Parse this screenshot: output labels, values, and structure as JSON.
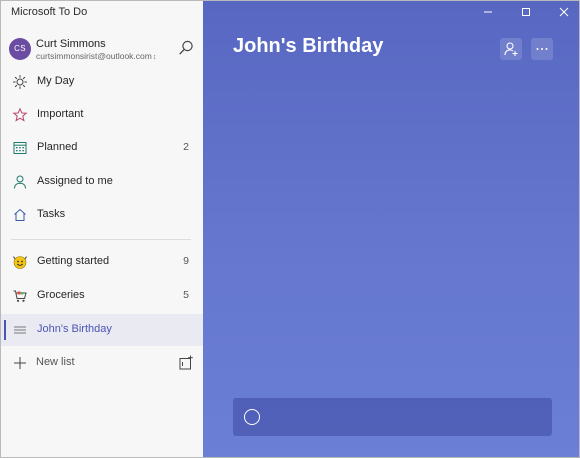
{
  "app": {
    "title": "Microsoft To Do"
  },
  "account": {
    "initials": "CS",
    "name": "Curt Simmons",
    "email": "curtsimmonsirist@outlook.com",
    "chevron": "⌃⌄"
  },
  "sidebar": {
    "smart_lists": [
      {
        "label": "My Day",
        "icon": "sun-icon",
        "count": ""
      },
      {
        "label": "Important",
        "icon": "star-icon",
        "count": ""
      },
      {
        "label": "Planned",
        "icon": "calendar-icon",
        "count": "2"
      },
      {
        "label": "Assigned to me",
        "icon": "person-icon",
        "count": ""
      },
      {
        "label": "Tasks",
        "icon": "home-icon",
        "count": ""
      }
    ],
    "lists": [
      {
        "label": "Getting started",
        "icon": "smiley-emoji-icon",
        "count": "9"
      },
      {
        "label": "Groceries",
        "icon": "shopping-cart-emoji-icon",
        "count": "5"
      },
      {
        "label": "John's Birthday",
        "icon": "list-lines-icon",
        "count": "",
        "active": true
      }
    ],
    "new_list_label": "New list"
  },
  "main": {
    "title": "John's Birthday",
    "add_task_placeholder": "",
    "background_color": "#6273cc"
  },
  "colors": {
    "accent": "#4b55b3",
    "sidebar_bg": "#f7f7f7",
    "avatar_bg": "#6a4ca0"
  }
}
